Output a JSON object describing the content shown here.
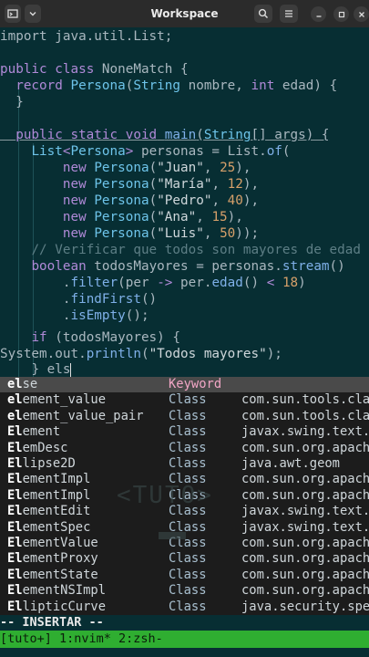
{
  "window": {
    "title": "Workspace",
    "icons": [
      "app-window-icon",
      "dropdown-icon",
      "search-icon",
      "menu-icon",
      "minimize-icon",
      "maximize-icon",
      "close-icon"
    ]
  },
  "code": {
    "l1a": "import java.util.List;",
    "l3_public": "public",
    "l3_class": "class",
    "l3_name": " NoneMatch {",
    "l4_record": "record",
    "l4_type": "Persona",
    "l4_p1": "(",
    "l4_string": "String",
    "l4_p2": " nombre, ",
    "l4_int": "int",
    "l4_p3": " edad) {",
    "l5": "}",
    "l7_public": "public static void",
    "l7_main": "main",
    "l7_p1": "(",
    "l7_string": "String",
    "l7_p2": "[] args) {",
    "l8_list": "List",
    "l8_lt": "<",
    "l8_persona": "Persona",
    "l8_gt": ">",
    "l8_rest": " personas = List.",
    "l8_of": "of",
    "l8_paren": "(",
    "persons": [
      {
        "new": "new",
        "type": "Persona",
        "name": "\"Juan\"",
        "age": "25",
        "end": "),"
      },
      {
        "new": "new",
        "type": "Persona",
        "name": "\"María\"",
        "age": "12",
        "end": "),"
      },
      {
        "new": "new",
        "type": "Persona",
        "name": "\"Pedro\"",
        "age": "40",
        "end": "),"
      },
      {
        "new": "new",
        "type": "Persona",
        "name": "\"Ana\"",
        "age": "15",
        "end": "),"
      },
      {
        "new": "new",
        "type": "Persona",
        "name": "\"Luis\"",
        "age": "50",
        "end": "));"
      }
    ],
    "comment": "// Verificar que todos son mayores de edad",
    "l15_bool": "boolean",
    "l15_rest": " todosMayores = personas.",
    "l15_stream": "stream",
    "l15_end": "()",
    "l16_dot": ".",
    "l16_filter": "filter",
    "l16_rest": "(per ",
    "l16_arrow": "->",
    "l16_rest2": " per.",
    "l16_edad": "edad",
    "l16_rest3": "() ",
    "l16_lt": "<",
    "l16_num": "18",
    "l16_end": ")",
    "l17_dot": ".",
    "l17_fn": "findFirst",
    "l17_end": "()",
    "l18_dot": ".",
    "l18_fn": "isEmpty",
    "l18_end": "();",
    "l20_if": "if",
    "l20_rest": " (todosMayores) {",
    "l21_sys": "System.out.",
    "l21_fn": "println",
    "l21_p": "(",
    "l21_str": "\"Todos mayores\"",
    "l21_end": ");",
    "l22_brace": "} ",
    "l22_typed": "els"
  },
  "completions": [
    {
      "match": "el",
      "rest": "se",
      "kind": "Keyword",
      "src": ""
    },
    {
      "match": "el",
      "rest": "ement_value",
      "kind": "Class",
      "src": "com.sun.tools.cla"
    },
    {
      "match": "el",
      "rest": "ement_value_pair",
      "kind": "Class",
      "src": "com.sun.tools.cla"
    },
    {
      "match": "El",
      "rest": "ement",
      "kind": "Class",
      "src": "javax.swing.text."
    },
    {
      "match": "El",
      "rest": "emDesc",
      "kind": "Class",
      "src": "com.sun.org.apach"
    },
    {
      "match": "El",
      "rest": "lipse2D",
      "kind": "Class",
      "src": "java.awt.geom"
    },
    {
      "match": "El",
      "rest": "ementImpl",
      "kind": "Class",
      "src": "com.sun.org.apach"
    },
    {
      "match": "El",
      "rest": "ementImpl",
      "kind": "Class",
      "src": "com.sun.org.apach"
    },
    {
      "match": "El",
      "rest": "ementEdit",
      "kind": "Class",
      "src": "javax.swing.text."
    },
    {
      "match": "El",
      "rest": "ementSpec",
      "kind": "Class",
      "src": "javax.swing.text."
    },
    {
      "match": "El",
      "rest": "ementValue",
      "kind": "Class",
      "src": "com.sun.org.apach"
    },
    {
      "match": "El",
      "rest": "ementProxy",
      "kind": "Class",
      "src": "com.sun.org.apach"
    },
    {
      "match": "El",
      "rest": "ementState",
      "kind": "Class",
      "src": "com.sun.org.apach"
    },
    {
      "match": "El",
      "rest": "ementNSImpl",
      "kind": "Class",
      "src": "com.sun.org.apach"
    },
    {
      "match": "El",
      "rest": "lipticCurve",
      "kind": "Class",
      "src": "java.security.spe"
    }
  ],
  "mode": "-- INSERTAR --",
  "tmux": "[tuto+] 1:nvim* 2:zsh-",
  "colors": {
    "background": "#072e33",
    "tmux_bar": "#2fae31",
    "keyword": "#b08ad8",
    "type": "#6ec4ea"
  }
}
